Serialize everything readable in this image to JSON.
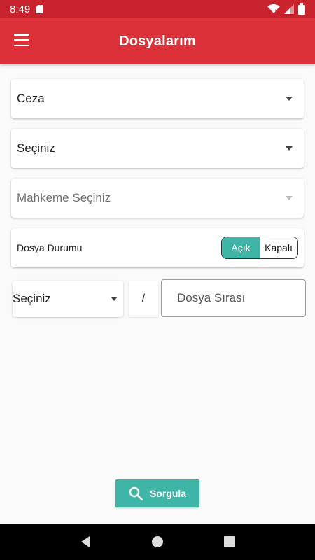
{
  "status_bar": {
    "time": "8:49"
  },
  "app_bar": {
    "title": "Dosyalarım"
  },
  "filters": {
    "category": {
      "value": "Ceza"
    },
    "court_type": {
      "value": "Seçiniz"
    },
    "court": {
      "placeholder": "Mahkeme Seçiniz"
    }
  },
  "file_status": {
    "label": "Dosya Durumu",
    "options": [
      "Açık",
      "Kapalı"
    ],
    "selected": "Açık"
  },
  "file_number": {
    "year_value": "Seçiniz",
    "separator": "/",
    "sequence_placeholder": "Dosya Sırası"
  },
  "actions": {
    "query_label": "Sorgula"
  },
  "colors": {
    "primary": "#dc3139",
    "status_bar": "#c8222c",
    "accent": "#3fb5a8"
  }
}
